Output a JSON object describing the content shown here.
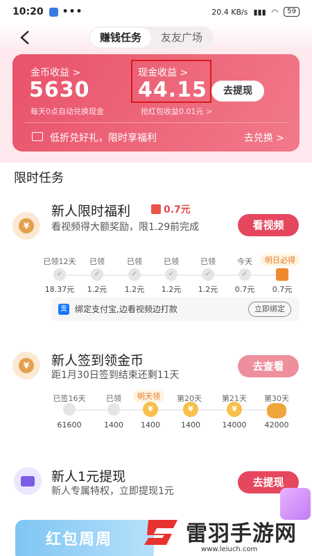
{
  "status": {
    "time": "10:20",
    "dots": "•••",
    "net": "20.4 KB/s",
    "battery": "59"
  },
  "header": {
    "tabs": [
      "赚钱任务",
      "友友广场"
    ]
  },
  "card": {
    "coin_label": "金币收益 >",
    "coin_value": "5630",
    "coin_sub": "每天0点自动兑换现金",
    "cash_label": "现金收益 >",
    "cash_value": "44.15",
    "cash_sub": "抢红包收益0.01元 >",
    "withdraw": "去提现",
    "promo_text": "低折兑好礼，限时享福利",
    "promo_link": "去兑换 >"
  },
  "section_title": "限时任务",
  "task1": {
    "title": "新人限时福利",
    "reward": "0.7元",
    "desc": "看视频得大额奖励，限1.29前完成",
    "button": "看视频",
    "labels": [
      "已领12天",
      "已领",
      "已领",
      "已领",
      "已领",
      "今天",
      "明日必得"
    ],
    "values": [
      "18.37元",
      "1.2元",
      "1.2元",
      "1.2元",
      "1.2元",
      "0.7元",
      "0.7元"
    ],
    "alipay_text": "绑定支付宝,边看视频边打款",
    "alipay_button": "立即绑定"
  },
  "task2": {
    "title": "新人签到领金币",
    "desc": "距1月30日签到结束还剩11天",
    "button": "去查看",
    "labels": [
      "已签16天",
      "已领",
      "明天领",
      "第20天",
      "第21天",
      "第30天"
    ],
    "values": [
      "61600",
      "1400",
      "1400",
      "1400",
      "14000",
      "42000"
    ]
  },
  "task3": {
    "title": "新人1元提现",
    "desc": "新人专属特权，立即提现1元",
    "button": "去提现"
  },
  "banner": {
    "text": "红包周周"
  },
  "watermark": {
    "text": "雷羽手游网",
    "url": "www.leiuch.com"
  },
  "colors": {
    "accent": "#e5475f",
    "card_start": "#e9526b",
    "card_end": "#f17a8a"
  }
}
